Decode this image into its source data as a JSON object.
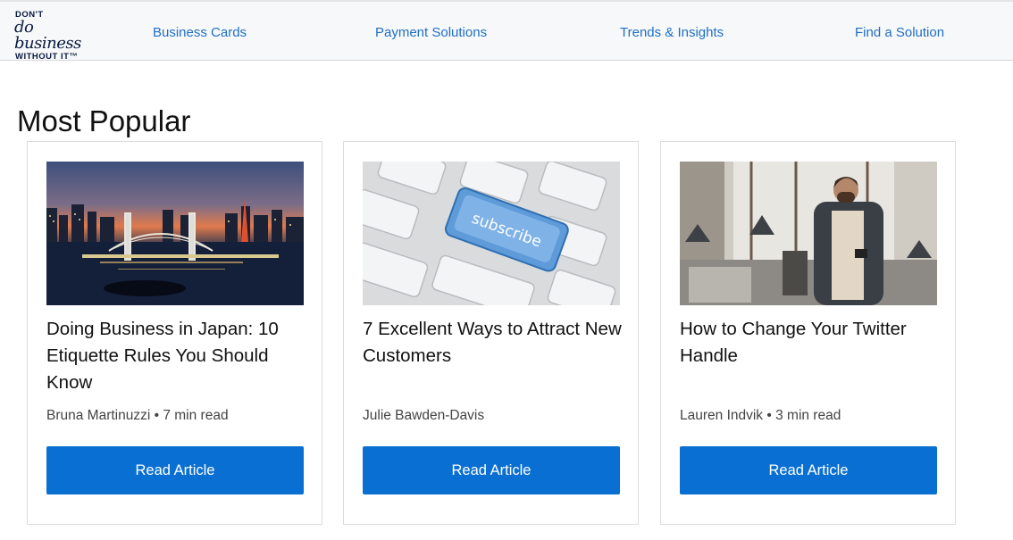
{
  "logo": {
    "line1": "DON'T",
    "line2": "do business",
    "line3": "WITHOUT IT™"
  },
  "nav": {
    "items": [
      {
        "label": "Business Cards"
      },
      {
        "label": "Payment Solutions"
      },
      {
        "label": "Trends & Insights"
      },
      {
        "label": "Find a Solution"
      }
    ]
  },
  "main": {
    "title": "Most Popular",
    "cards": [
      {
        "image": "tokyo-rainbow-bridge-photo",
        "title": "Doing Business in Japan: 10 Etiquette Rules You Should Know",
        "meta": "Bruna Martinuzzi • 7 min read",
        "button": "Read Article"
      },
      {
        "image": "subscribe-keyboard-photo",
        "image_text": "subscribe",
        "title": "7 Excellent Ways to Attract New Customers",
        "meta": "Julie Bawden-Davis",
        "button": "Read Article"
      },
      {
        "image": "man-using-phone-photo",
        "title": "How to Change Your Twitter Handle",
        "meta": "Lauren Indvik • 3 min read",
        "button": "Read Article"
      }
    ]
  },
  "colors": {
    "link": "#1f6fc6",
    "button": "#0a6fd3",
    "brand_navy": "#0a1b3f"
  }
}
